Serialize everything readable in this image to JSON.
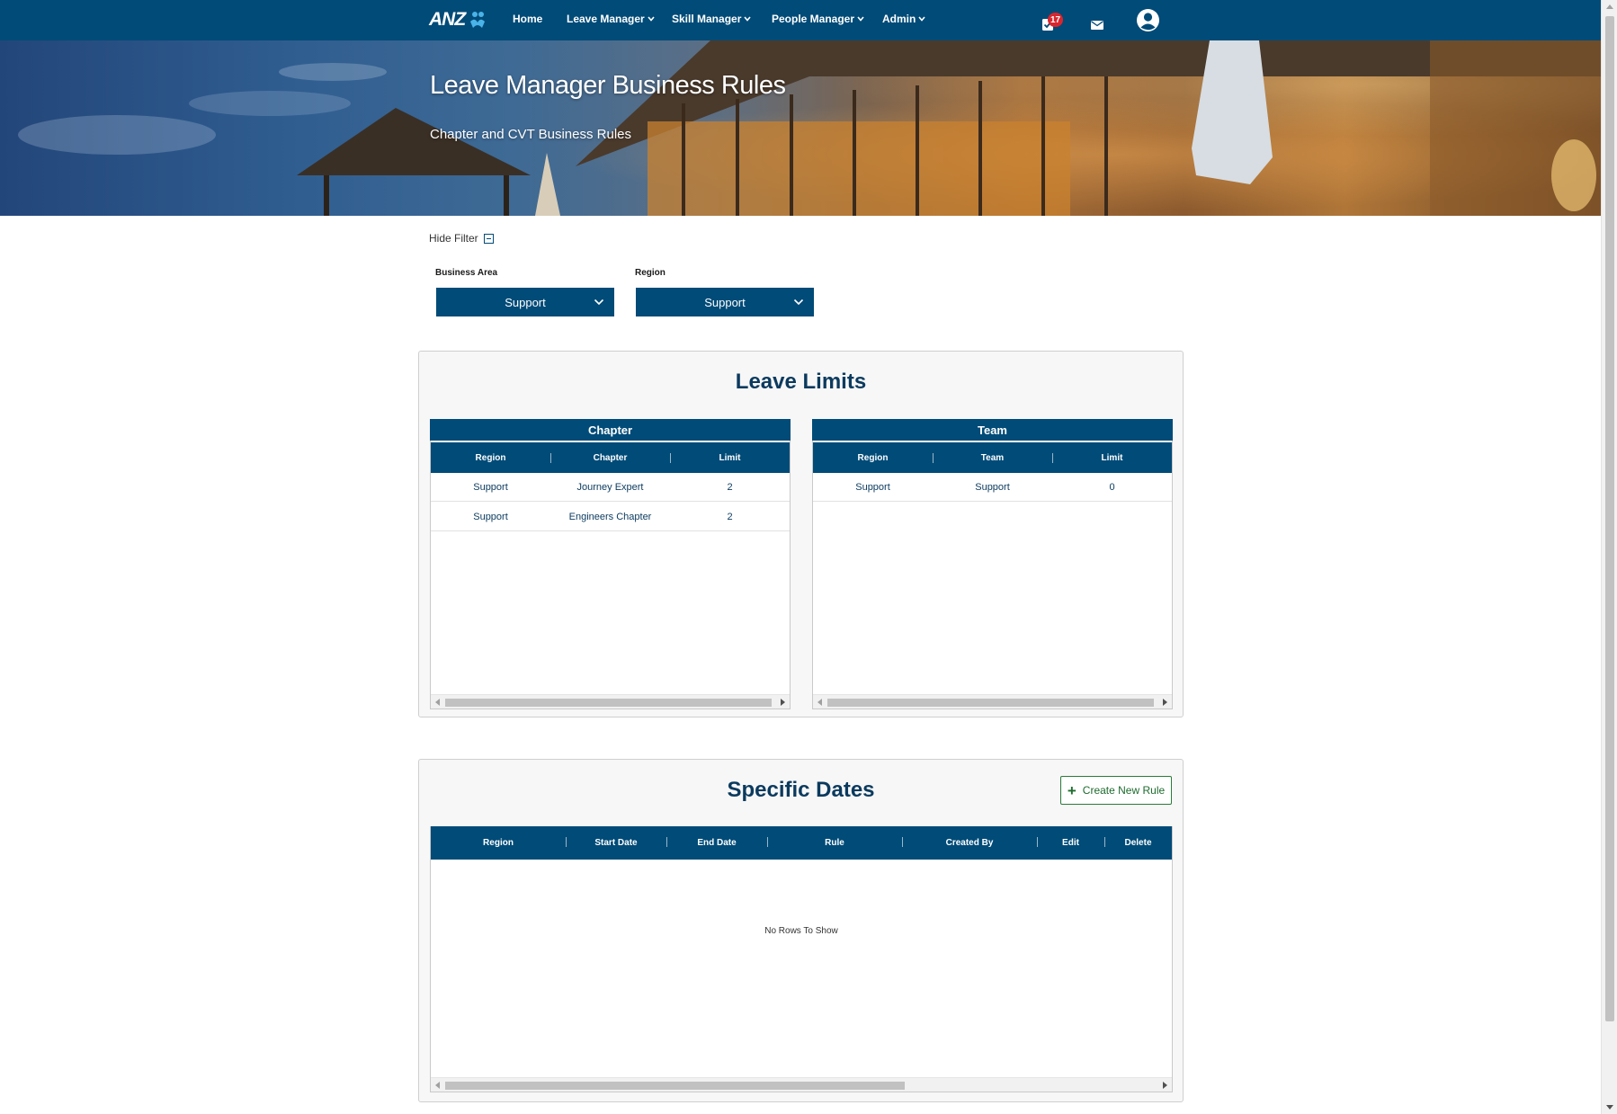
{
  "nav": {
    "logo_text": "ANZ",
    "items": [
      {
        "label": "Home",
        "dropdown": false
      },
      {
        "label": "Leave Manager",
        "dropdown": true
      },
      {
        "label": "Skill Manager",
        "dropdown": true
      },
      {
        "label": "People Manager",
        "dropdown": true
      },
      {
        "label": "Admin",
        "dropdown": true
      }
    ],
    "notification_count": "17",
    "icons": [
      "tasks-icon",
      "mail-icon",
      "user-account-icon"
    ]
  },
  "hero": {
    "title": "Leave Manager Business Rules",
    "subtitle": "Chapter and CVT Business Rules"
  },
  "filter": {
    "toggle_label": "Hide Filter",
    "business_area": {
      "label": "Business Area",
      "value": "Support"
    },
    "region": {
      "label": "Region",
      "value": "Support"
    }
  },
  "leave_limits": {
    "title": "Leave Limits",
    "chapter": {
      "caption": "Chapter",
      "columns": [
        "Region",
        "Chapter",
        "Limit"
      ],
      "rows": [
        [
          "Support",
          "Journey Expert",
          "2"
        ],
        [
          "Support",
          "Engineers Chapter",
          "2"
        ]
      ]
    },
    "team": {
      "caption": "Team",
      "columns": [
        "Region",
        "Team",
        "Limit"
      ],
      "rows": [
        [
          "Support",
          "Support",
          "0"
        ]
      ]
    }
  },
  "specific_dates": {
    "title": "Specific Dates",
    "create_button": "Create New Rule",
    "columns": [
      "Region",
      "Start Date",
      "End Date",
      "Rule",
      "Created By",
      "Edit",
      "Delete"
    ],
    "empty_text": "No Rows To Show"
  },
  "colors": {
    "primary": "#004b78",
    "title_text": "#0b3a5e",
    "create_button": "#1e6b2e",
    "badge": "#d9262e"
  }
}
